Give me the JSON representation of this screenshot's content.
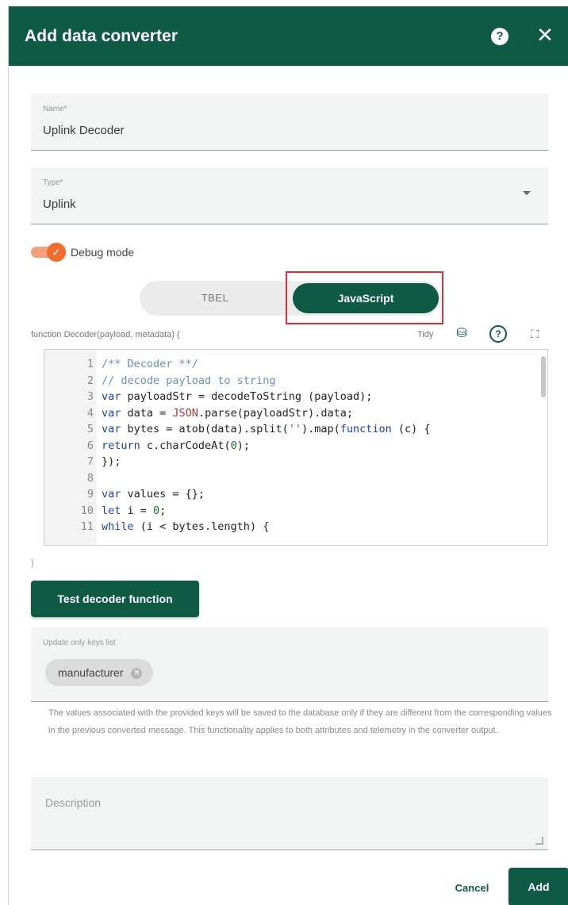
{
  "dialog": {
    "title": "Add data converter",
    "help_icon": "help-circle-icon",
    "close_icon": "close-icon"
  },
  "name_field": {
    "label": "Name*",
    "value": "Uplink Decoder"
  },
  "type_field": {
    "label": "Type*",
    "value": "Uplink"
  },
  "debug_mode": {
    "label": "Debug mode",
    "checked": true
  },
  "language_toggle": {
    "options": [
      "TBEL",
      "JavaScript"
    ],
    "selected": "JavaScript"
  },
  "editor": {
    "signature": "function Decoder(payload, metadata) {",
    "tidy_label": "Tidy",
    "lines": [
      {
        "n": "1",
        "code": "/** Decoder **/"
      },
      {
        "n": "2",
        "code": "// decode payload to string"
      },
      {
        "n": "3",
        "code": "var payloadStr = decodeToString (payload);"
      },
      {
        "n": "4",
        "code": "var data = JSON.parse(payloadStr).data;"
      },
      {
        "n": "5",
        "code": "var bytes = atob(data).split('').map(function (c) {"
      },
      {
        "n": "6",
        "code": "return c.charCodeAt(0);"
      },
      {
        "n": "7",
        "code": "});"
      },
      {
        "n": "8",
        "code": ""
      },
      {
        "n": "9",
        "code": "var values = {};"
      },
      {
        "n": "10",
        "code": "let i = 0;"
      },
      {
        "n": "11",
        "code": "while (i < bytes.length) {"
      }
    ],
    "closing": "}"
  },
  "test_button": {
    "label": "Test decoder function"
  },
  "update_keys": {
    "label": "Update only keys list",
    "chips": [
      "manufacturer"
    ],
    "hint": "The values associated with the provided keys will be saved to the database only if they are different from the corresponding values in the previous converted message. This functionality applies to both attributes and telemetry in the converter output."
  },
  "description": {
    "placeholder": "Description"
  },
  "actions": {
    "cancel_label": "Cancel",
    "add_label": "Add"
  },
  "colors": {
    "primary": "#0e5a45",
    "accent": "#f26b2a",
    "highlight": "#d9343a"
  }
}
